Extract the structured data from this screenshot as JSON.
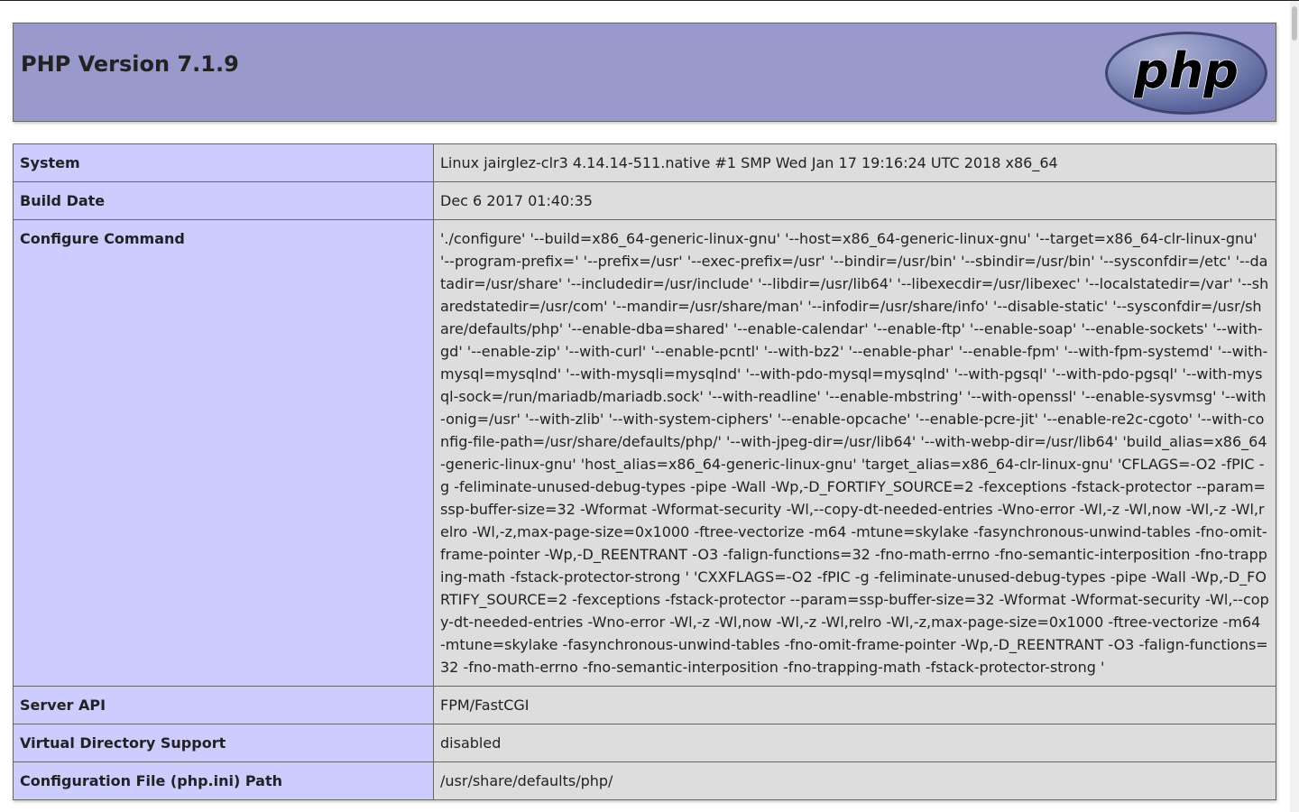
{
  "header": {
    "title": "PHP Version 7.1.9",
    "logo_text": "php"
  },
  "rows": [
    {
      "key": "System",
      "value": "Linux jairglez-clr3 4.14.14-511.native #1 SMP Wed Jan 17 19:16:24 UTC 2018 x86_64"
    },
    {
      "key": "Build Date",
      "value": "Dec 6 2017 01:40:35"
    },
    {
      "key": "Configure Command",
      "value": "'./configure' '--build=x86_64-generic-linux-gnu' '--host=x86_64-generic-linux-gnu' '--target=x86_64-clr-linux-gnu' '--program-prefix=' '--prefix=/usr' '--exec-prefix=/usr' '--bindir=/usr/bin' '--sbindir=/usr/bin' '--sysconfdir=/etc' '--datadir=/usr/share' '--includedir=/usr/include' '--libdir=/usr/lib64' '--libexecdir=/usr/libexec' '--localstatedir=/var' '--sharedstatedir=/usr/com' '--mandir=/usr/share/man' '--infodir=/usr/share/info' '--disable-static' '--sysconfdir=/usr/share/defaults/php' '--enable-dba=shared' '--enable-calendar' '--enable-ftp' '--enable-soap' '--enable-sockets' '--with-gd' '--enable-zip' '--with-curl' '--enable-pcntl' '--with-bz2' '--enable-phar' '--enable-fpm' '--with-fpm-systemd' '--with-mysql=mysqlnd' '--with-mysqli=mysqlnd' '--with-pdo-mysql=mysqlnd' '--with-pgsql' '--with-pdo-pgsql' '--with-mysql-sock=/run/mariadb/mariadb.sock' '--with-readline' '--enable-mbstring' '--with-openssl' '--enable-sysvmsg' '--with-onig=/usr' '--with-zlib' '--with-system-ciphers' '--enable-opcache' '--enable-pcre-jit' '--enable-re2c-cgoto' '--with-config-file-path=/usr/share/defaults/php/' '--with-jpeg-dir=/usr/lib64' '--with-webp-dir=/usr/lib64' 'build_alias=x86_64-generic-linux-gnu' 'host_alias=x86_64-generic-linux-gnu' 'target_alias=x86_64-clr-linux-gnu' 'CFLAGS=-O2 -fPIC -g -feliminate-unused-debug-types -pipe -Wall -Wp,-D_FORTIFY_SOURCE=2 -fexceptions -fstack-protector --param=ssp-buffer-size=32 -Wformat -Wformat-security -Wl,--copy-dt-needed-entries -Wno-error -Wl,-z -Wl,now -Wl,-z -Wl,relro -Wl,-z,max-page-size=0x1000 -ftree-vectorize -m64 -mtune=skylake -fasynchronous-unwind-tables -fno-omit-frame-pointer -Wp,-D_REENTRANT -O3 -falign-functions=32 -fno-math-errno -fno-semantic-interposition -fno-trapping-math -fstack-protector-strong ' 'CXXFLAGS=-O2 -fPIC -g -feliminate-unused-debug-types -pipe -Wall -Wp,-D_FORTIFY_SOURCE=2 -fexceptions -fstack-protector --param=ssp-buffer-size=32 -Wformat -Wformat-security -Wl,--copy-dt-needed-entries -Wno-error -Wl,-z -Wl,now -Wl,-z -Wl,relro -Wl,-z,max-page-size=0x1000 -ftree-vectorize -m64 -mtune=skylake -fasynchronous-unwind-tables -fno-omit-frame-pointer -Wp,-D_REENTRANT -O3 -falign-functions=32 -fno-math-errno -fno-semantic-interposition -fno-trapping-math -fstack-protector-strong '"
    },
    {
      "key": "Server API",
      "value": "FPM/FastCGI"
    },
    {
      "key": "Virtual Directory Support",
      "value": "disabled"
    },
    {
      "key": "Configuration File (php.ini) Path",
      "value": "/usr/share/defaults/php/"
    }
  ],
  "colors": {
    "header_bg": "#9999cc",
    "key_bg": "#ccccff",
    "value_bg": "#dddddd",
    "border": "#666666",
    "logo_bg": "#6c78af",
    "logo_text": "#000000"
  }
}
